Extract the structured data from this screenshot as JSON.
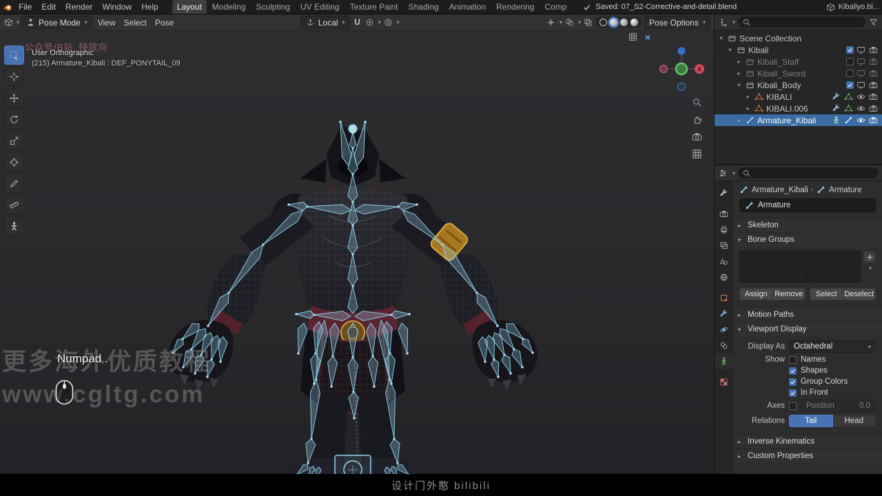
{
  "colors": {
    "accent": "#4772b3",
    "selection": "#3a6ca3",
    "bone": "#8fd0e8",
    "gold": "#c8912f"
  },
  "topbar": {
    "menus": [
      "File",
      "Edit",
      "Render",
      "Window",
      "Help"
    ],
    "workspaces": [
      {
        "label": "Layout",
        "active": true
      },
      {
        "label": "Modeling",
        "active": false
      },
      {
        "label": "Sculpting",
        "active": false
      },
      {
        "label": "UV Editing",
        "active": false
      },
      {
        "label": "Texture Paint",
        "active": false
      },
      {
        "label": "Shading",
        "active": false
      },
      {
        "label": "Animation",
        "active": false
      },
      {
        "label": "Rendering",
        "active": false
      },
      {
        "label": "Comp",
        "active": false
      }
    ],
    "save_status": "Saved: 07_S2-Corrective-and-detail.blend",
    "file_label": "Kibaliyo.bl..."
  },
  "viewport_header": {
    "mode_label": "Pose Mode",
    "menus": [
      "View",
      "Select",
      "Pose"
    ],
    "orientation_label": "Local",
    "pose_options_label": "Pose Options"
  },
  "tool_shelf": {
    "tools": [
      {
        "icon": "select-box-icon",
        "active": true
      },
      {
        "icon": "cursor-tool-icon",
        "active": false
      },
      {
        "icon": "move-icon",
        "active": false
      },
      {
        "icon": "rotate-icon",
        "active": false
      },
      {
        "icon": "scale-icon",
        "active": false
      },
      {
        "icon": "transform-icon",
        "active": false
      },
      {
        "icon": "annotate-icon",
        "active": false
      },
      {
        "icon": "measure-icon",
        "active": false
      },
      {
        "icon": "pose-tool-icon",
        "active": false
      }
    ]
  },
  "viewport": {
    "view_label": "User Orthographic",
    "active_item_label": "(215) Armature_Kibali : DEF_PONYTAIL_09",
    "watermark_pink": "公众号/B站_特效向",
    "watermark_line1": "更多海外优质教程",
    "watermark_line2": "www.cgltg.com",
    "key_hint": "Numpad .",
    "gizmo_x_label": "X",
    "nav_icons": [
      "zoom-icon",
      "hand-icon",
      "camera-icon",
      "grid-icon"
    ]
  },
  "outliner": {
    "rows": [
      {
        "label": "Scene Collection",
        "depth": 0,
        "icon": "scene-collection-icon",
        "icon_color": "#c8c8c8",
        "arrow": "open",
        "extras": [],
        "controls": []
      },
      {
        "label": "Kibali",
        "depth": 1,
        "icon": "collection-icon",
        "icon_color": "#c8c8c8",
        "arrow": "open",
        "extras": [],
        "controls": [
          "checkbox-on",
          "screen",
          "camera"
        ]
      },
      {
        "label": "Kibali_Staff",
        "depth": 2,
        "icon": "collection-icon",
        "icon_color": "#8a8a8a",
        "arrow": "closed",
        "dim": true,
        "extras": [],
        "controls": [
          "checkbox-off",
          "screen",
          "camera"
        ]
      },
      {
        "label": "Kibali_Sword",
        "depth": 2,
        "icon": "collection-icon",
        "icon_color": "#8a8a8a",
        "arrow": "closed",
        "dim": true,
        "extras": [],
        "controls": [
          "checkbox-off",
          "screen",
          "camera"
        ]
      },
      {
        "label": "Kibali_Body",
        "depth": 2,
        "icon": "collection-icon",
        "icon_color": "#c8c8c8",
        "arrow": "open",
        "extras": [],
        "controls": [
          "checkbox-on",
          "screen",
          "camera"
        ]
      },
      {
        "label": "KIBALI",
        "depth": 3,
        "icon": "mesh-icon",
        "icon_color": "#e0854e",
        "arrow": "closed",
        "extras": [
          {
            "icon": "modifier-icon",
            "color": "#8ab4d8"
          },
          {
            "icon": "mesh-data-icon",
            "color": "#6fc06f"
          }
        ],
        "controls": [
          "eye",
          "camera"
        ]
      },
      {
        "label": "KIBALI.006",
        "depth": 3,
        "icon": "mesh-icon",
        "icon_color": "#e0854e",
        "arrow": "closed",
        "extras": [
          {
            "icon": "modifier-icon",
            "color": "#8ab4d8"
          },
          {
            "icon": "mesh-data-icon",
            "color": "#6fc06f"
          }
        ],
        "controls": [
          "eye",
          "camera"
        ]
      },
      {
        "label": "Armature_Kibali",
        "depth": 2,
        "icon": "armature-icon",
        "icon_color": "#8fd0e8",
        "arrow": "closed",
        "selected": true,
        "extras": [
          {
            "icon": "pose-icon",
            "color": "#b8e6b8"
          },
          {
            "icon": "armature-data-icon",
            "color": "#bfe8f5"
          }
        ],
        "controls": [
          "eye",
          "camera"
        ]
      }
    ]
  },
  "properties": {
    "breadcrumb": [
      {
        "icon": "armature-icon",
        "label": "Armature_Kibali"
      },
      {
        "icon": "armature-icon",
        "label": "Armature"
      }
    ],
    "name_value": "Armature",
    "tabs": [
      {
        "icon": "tool-icon"
      },
      {
        "gap": true
      },
      {
        "icon": "render-icon"
      },
      {
        "icon": "output-icon"
      },
      {
        "icon": "view-layer-icon"
      },
      {
        "icon": "scene-icon"
      },
      {
        "icon": "world-icon"
      },
      {
        "gap": true
      },
      {
        "icon": "object-icon",
        "color": "#e0854e"
      },
      {
        "icon": "modifier-icon",
        "color": "#7fa8cf"
      },
      {
        "icon": "physics-icon",
        "color": "#7fa8cf"
      },
      {
        "icon": "constraint-icon"
      },
      {
        "icon": "data-icon",
        "color": "#6fc06f",
        "active": true
      },
      {
        "gap": true
      },
      {
        "icon": "texture-icon",
        "color": "#c97070"
      }
    ],
    "panel_labels": {
      "skeleton": "Skeleton",
      "bone_groups": "Bone Groups",
      "motion_paths": "Motion Paths",
      "viewport_display": "Viewport Display",
      "inverse_kinematics": "Inverse Kinematics",
      "custom_properties": "Custom Properties"
    },
    "bone_group_buttons": [
      "Assign",
      "Remove",
      "Select",
      "Deselect"
    ],
    "viewport_display": {
      "display_as_label": "Display As",
      "display_as_value": "Octahedral",
      "show_label": "Show",
      "options": [
        {
          "label": "Names",
          "checked": false
        },
        {
          "label": "Shapes",
          "checked": true
        },
        {
          "label": "Group Colors",
          "checked": true
        },
        {
          "label": "In Front",
          "checked": true
        }
      ],
      "axes_label": "Axes",
      "axes_checked": false,
      "position_label": "Position",
      "position_value": "0.0",
      "relations_label": "Relations",
      "relations": [
        {
          "label": "Tail",
          "active": true
        },
        {
          "label": "Head",
          "active": false
        }
      ]
    }
  },
  "bottom_bar": {
    "watermark": "设计门外憨 bilibili"
  }
}
